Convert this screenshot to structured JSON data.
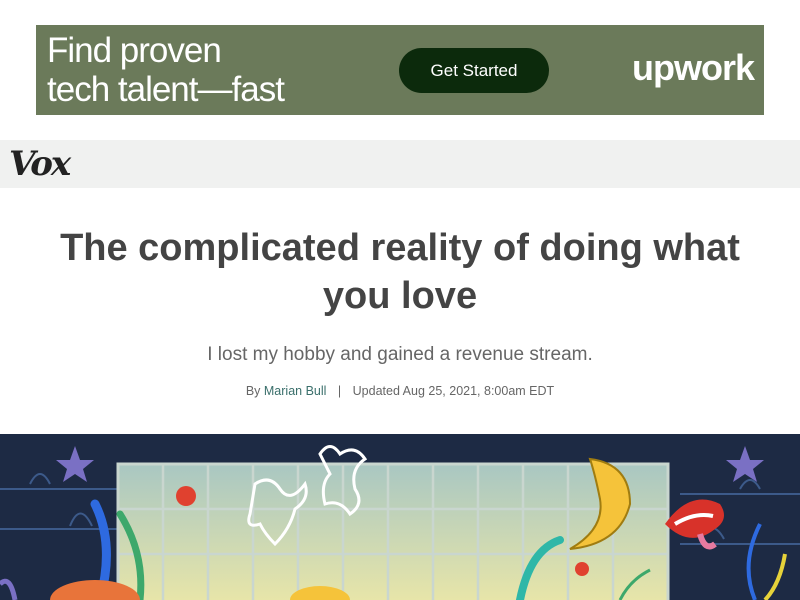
{
  "ad": {
    "headline_line1": "Find proven",
    "headline_line2": "tech talent—fast",
    "cta_label": "Get Started",
    "brand": "upwork",
    "background_color": "#6b7a5a",
    "cta_color": "#0c2a0c"
  },
  "nav": {
    "logo": "Vox"
  },
  "article": {
    "title": "The complicated reality of doing what you love",
    "subtitle": "I lost my hobby and gained a revenue stream.",
    "byline_prefix": "By",
    "author": "Marian Bull",
    "separator": "|",
    "updated": "Updated Aug 25, 2021, 8:00am EDT"
  },
  "hero": {
    "description_icon": "illustration"
  }
}
